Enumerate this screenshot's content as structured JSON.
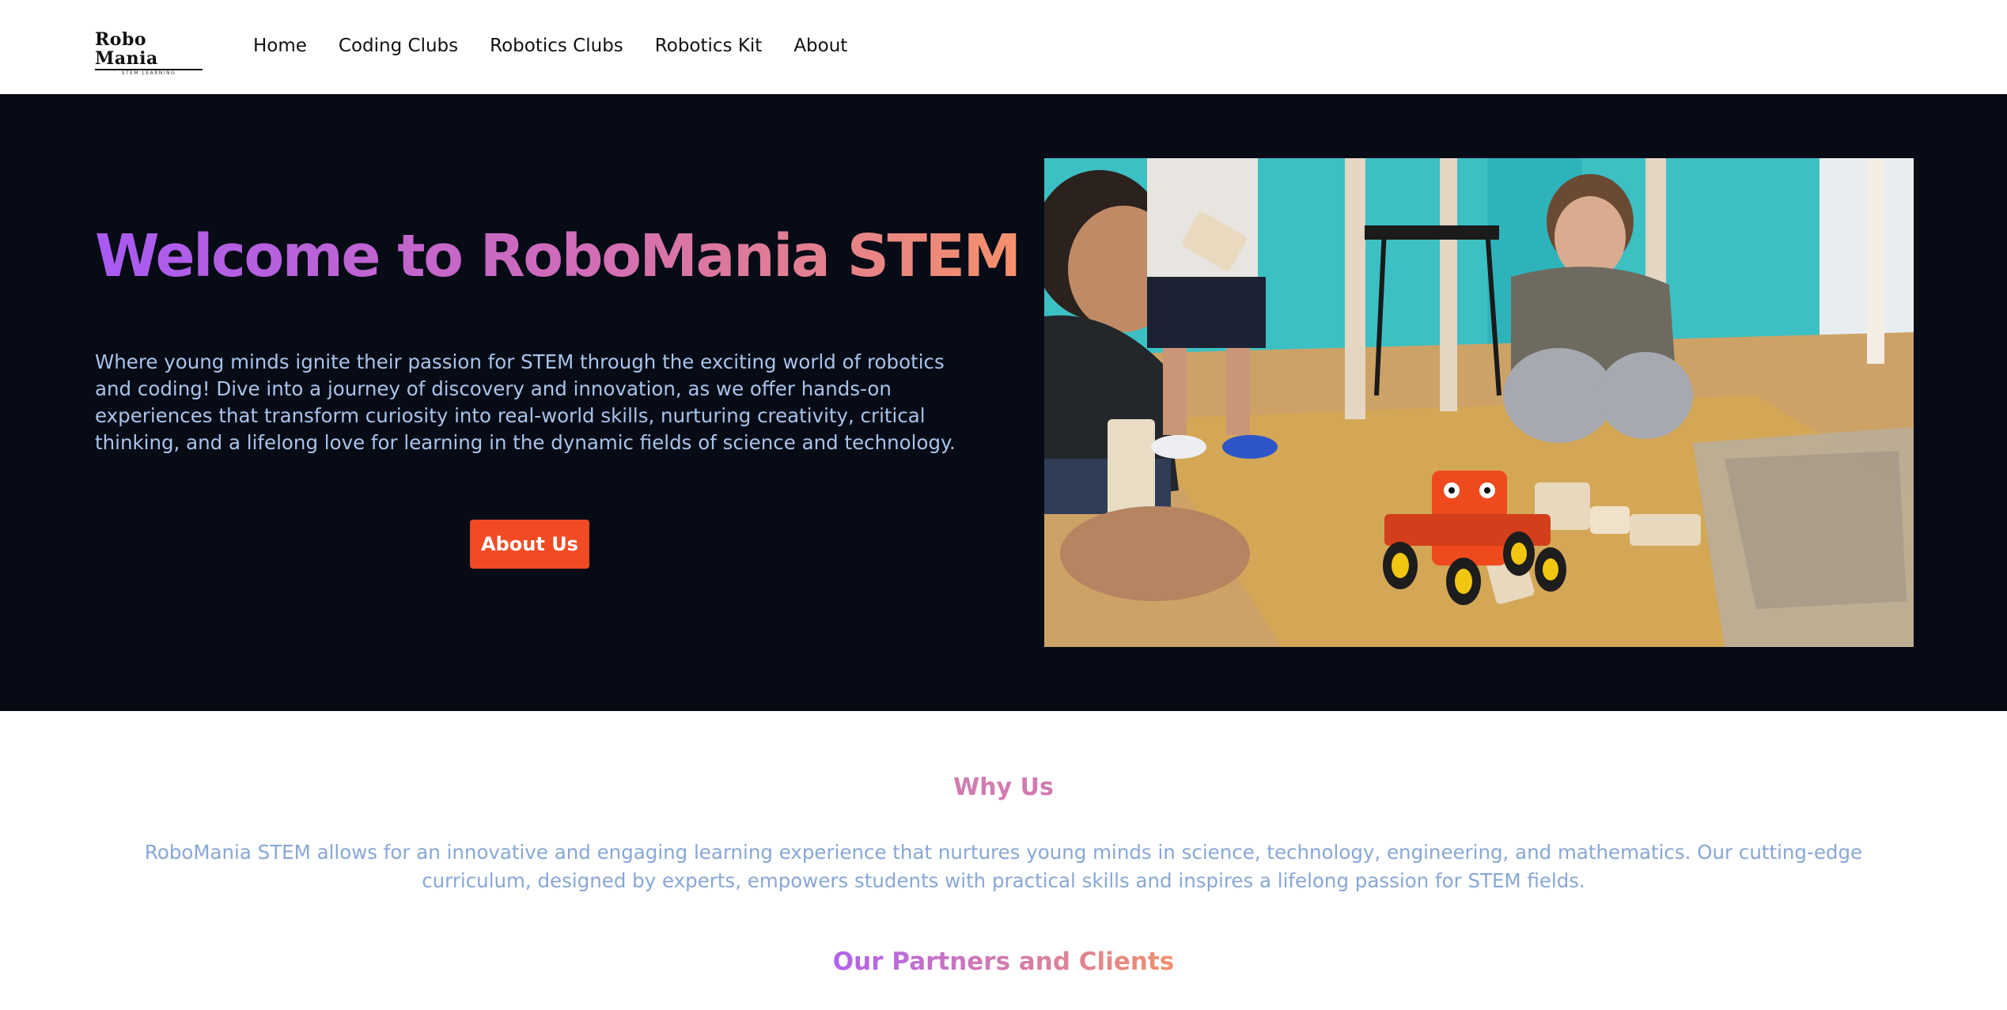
{
  "nav": {
    "logo_main": "Robo Mania",
    "logo_sub": "STEM LEARNING",
    "items": [
      {
        "label": "Home"
      },
      {
        "label": "Coding Clubs"
      },
      {
        "label": "Robotics Clubs"
      },
      {
        "label": "Robotics Kit"
      },
      {
        "label": "About"
      }
    ]
  },
  "hero": {
    "title": "Welcome to RoboMania STEM",
    "description": "Where young minds ignite their passion for STEM through the exciting world of robotics and coding! Dive into a journey of discovery and innovation, as we offer hands-on experiences that transform curiosity into real-world skills, nurturing creativity, critical thinking, and a lifelong love for learning in the dynamic fields of science and technology.",
    "button_label": "About Us"
  },
  "why_us": {
    "title": "Why Us",
    "text": "RoboMania STEM allows for an innovative and engaging learning experience that nurtures young minds in science, technology, engineering, and mathematics. Our cutting-edge curriculum, designed by experts, empowers students with practical skills and inspires a lifelong passion for STEM fields."
  },
  "partners": {
    "title": "Our Partners and Clients"
  },
  "colors": {
    "hero_bg": "#060b16",
    "button_bg": "#f24a24",
    "gradient_start": "#a85af2",
    "gradient_end": "#f4906a",
    "body_text": "#a9c4ea"
  }
}
